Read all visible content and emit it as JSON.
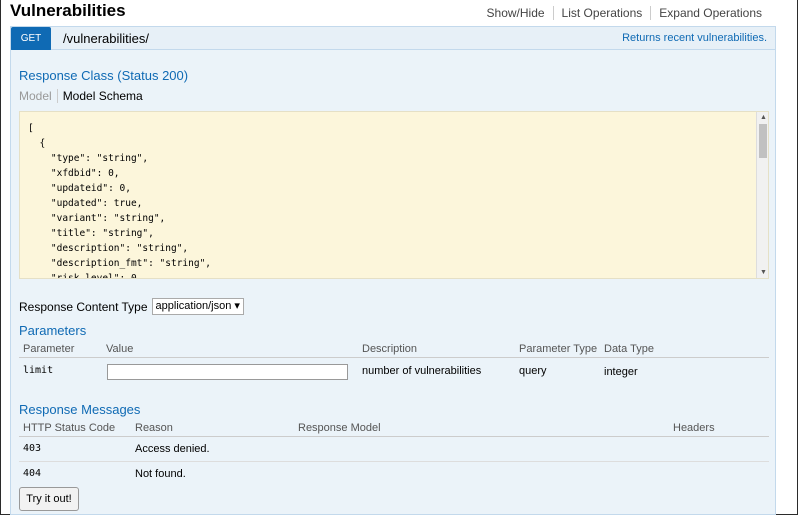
{
  "header": {
    "title": "Vulnerabilities",
    "ops": [
      "Show/Hide",
      "List Operations",
      "Expand Operations"
    ]
  },
  "operation": {
    "method": "GET",
    "path": "/vulnerabilities/",
    "summary": "Returns recent vulnerabilities."
  },
  "response_class": {
    "heading": "Response Class (Status 200)",
    "tab_model": "Model",
    "tab_schema": "Model Schema",
    "schema_text": "[\n  {\n    \"type\": \"string\",\n    \"xfdbid\": 0,\n    \"updateid\": 0,\n    \"updated\": true,\n    \"variant\": \"string\",\n    \"title\": \"string\",\n    \"description\": \"string\",\n    \"description_fmt\": \"string\",\n    \"risk_level\": 0,"
  },
  "content_type": {
    "label": "Response Content Type",
    "value": "application/json ▾"
  },
  "parameters": {
    "heading": "Parameters",
    "columns": [
      "Parameter",
      "Value",
      "Description",
      "Parameter Type",
      "Data Type"
    ],
    "rows": [
      {
        "name": "limit",
        "value": "",
        "description": "number of vulnerabilities",
        "param_type": "query",
        "data_type": "integer"
      }
    ]
  },
  "response_messages": {
    "heading": "Response Messages",
    "columns": [
      "HTTP Status Code",
      "Reason",
      "Response Model",
      "Headers"
    ],
    "rows": [
      {
        "code": "403",
        "reason": "Access denied."
      },
      {
        "code": "404",
        "reason": "Not found."
      }
    ]
  },
  "try_button": "Try it out!",
  "colors": {
    "accent": "#0f6ab4",
    "panel_bg": "#ebf3f9",
    "schema_bg": "#fcf6db"
  },
  "icons": {
    "scroll_up": "scroll-up-arrow-icon",
    "scroll_down": "scroll-down-arrow-icon",
    "select_chevron": "chevron-down-icon"
  }
}
